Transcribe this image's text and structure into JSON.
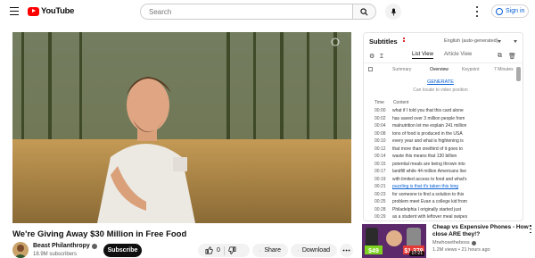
{
  "header": {
    "logo_text": "YouTube",
    "search_placeholder": "Search",
    "signin_label": "Sign in"
  },
  "video": {
    "title": "We're Giving Away $30 Million in Free Food"
  },
  "channel": {
    "name": "Beast Philanthropy",
    "subscribers": "18.9M subscribers",
    "subscribe_label": "Subscribe"
  },
  "actions": {
    "likes": "0",
    "share_label": "Share",
    "download_label": "Download"
  },
  "subtitles_panel": {
    "title": "Subtitles",
    "language": "English (auto-generated)",
    "list_view_label": "List View",
    "article_view_label": "Article View",
    "tabs": [
      "Summary",
      "Overview",
      "Keypoint",
      "7 Minutes"
    ],
    "generate_label": "GENERATE",
    "locate_hint": "Can locate to video position",
    "col_time": "Time",
    "col_content": "Content",
    "rows": [
      {
        "time": "00:00",
        "text": "what if I told you that this card alone"
      },
      {
        "time": "00:02",
        "text": "has saved over 3 million people from"
      },
      {
        "time": "00:04",
        "text": "malnutrition let me explain 241 million"
      },
      {
        "time": "00:08",
        "text": "tons of food is produced in the USA"
      },
      {
        "time": "00:10",
        "text": "every year and what is frightening is"
      },
      {
        "time": "00:12",
        "text": "that more than onethird of it goes to"
      },
      {
        "time": "00:14",
        "text": "waste this means that 130 billion"
      },
      {
        "time": "00:15",
        "text": "potential meals are being thrown into"
      },
      {
        "time": "00:17",
        "text": "landfill while 44 million Americans live"
      },
      {
        "time": "00:19",
        "text": "with limited access to food and what's"
      },
      {
        "time": "00:21",
        "text": "puzzling is that it's taken this long"
      },
      {
        "time": "00:23",
        "text": "for someone to find a solution to this"
      },
      {
        "time": "00:25",
        "text": "problem meet Evan a college kid from"
      },
      {
        "time": "00:28",
        "text": "Philadelphia I originally started just"
      },
      {
        "time": "00:29",
        "text": "as a student with leftover meal swipes"
      }
    ],
    "highlighted_row": 10
  },
  "recommendation": {
    "title": "Cheap vs Expensive Phones - How close ARE they!?",
    "channel": "Mrwhosetheboss",
    "meta": "1.2M views • 21 hours ago",
    "duration": "17:21",
    "price_left": "$49",
    "price_right": "$1,379"
  }
}
